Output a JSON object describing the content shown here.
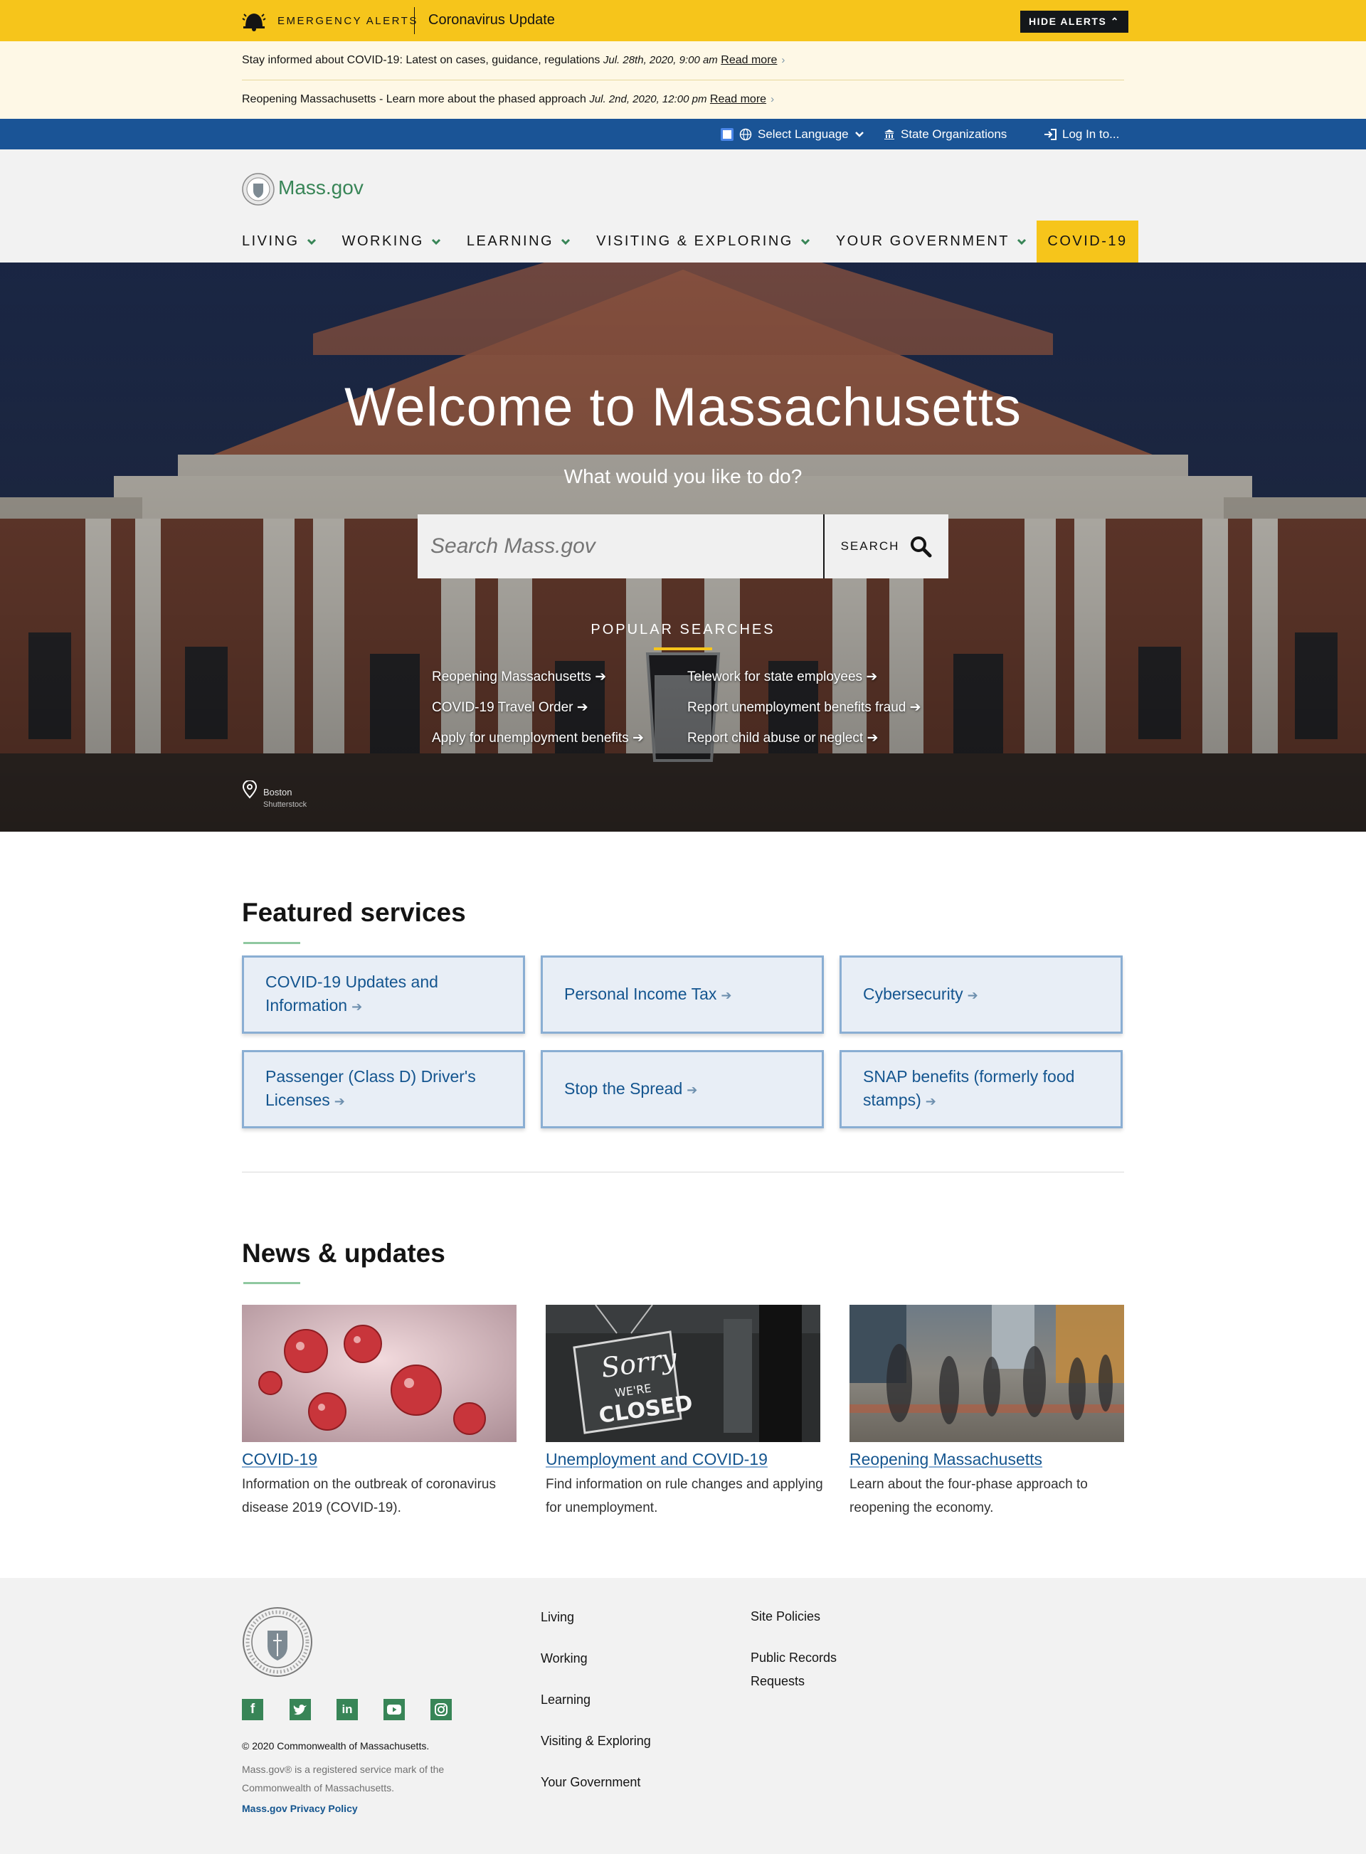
{
  "alerts": {
    "label": "EMERGENCY ALERTS",
    "title": "Coronavirus Update",
    "hide_button": "HIDE ALERTS",
    "items": [
      {
        "text": "Stay informed about COVID-19: Latest on cases, guidance, regulations",
        "date": "Jul. 28th, 2020, 9:00 am",
        "link": "Read more"
      },
      {
        "text": "Reopening Massachusetts - Learn more about the phased approach",
        "date": "Jul. 2nd, 2020, 12:00 pm",
        "link": "Read more"
      }
    ]
  },
  "utility": {
    "language": "Select Language",
    "orgs": "State Organizations",
    "login": "Log In to..."
  },
  "header": {
    "logo": "Mass.gov",
    "nav": [
      "LIVING",
      "WORKING",
      "LEARNING",
      "VISITING & EXPLORING",
      "YOUR GOVERNMENT"
    ],
    "covid": "COVID-19"
  },
  "hero": {
    "title": "Welcome to Massachusetts",
    "subtitle": "What would you like to do?",
    "search_placeholder": "Search Mass.gov",
    "search_button": "SEARCH",
    "popular_heading": "POPULAR SEARCHES",
    "popular": [
      "Reopening Massachusetts",
      "COVID-19 Travel Order",
      "Apply for unemployment benefits",
      "Telework for state employees",
      "Report unemployment benefits fraud",
      "Report child abuse or neglect"
    ],
    "caption_place": "Boston",
    "caption_credit": "Shutterstock"
  },
  "featured": {
    "title": "Featured services",
    "cards": [
      "COVID-19 Updates and Information",
      "Personal Income Tax",
      "Cybersecurity",
      "Passenger (Class D) Driver's Licenses",
      "Stop the Spread",
      "SNAP benefits (formerly food stamps)"
    ]
  },
  "news": {
    "title": "News & updates",
    "items": [
      {
        "title": "COVID-19",
        "desc": "Information on the outbreak of coronavirus disease 2019 (COVID-19)."
      },
      {
        "title": "Unemployment and COVID-19",
        "desc": "Find information on rule changes and applying for unemployment."
      },
      {
        "title": "Reopening Massachusetts",
        "desc": "Learn about the four-phase approach to reopening the economy."
      }
    ],
    "sign_line1": "Sorry",
    "sign_line2": "WE'RE",
    "sign_line3": "CLOSED"
  },
  "footer": {
    "copyright": "© 2020 Commonwealth of Massachusetts.",
    "trademark": "Mass.gov® is a registered service mark of the Commonwealth of Massachusetts.",
    "privacy": "Mass.gov Privacy Policy",
    "nav": [
      "Living",
      "Working",
      "Learning",
      "Visiting & Exploring",
      "Your Government"
    ],
    "policies": [
      "Site Policies",
      "Public Records Requests"
    ],
    "social": [
      "facebook-icon",
      "twitter-icon",
      "linkedin-icon",
      "youtube-icon",
      "instagram-icon"
    ]
  },
  "colors": {
    "alert_yellow": "#f6c51b",
    "util_blue": "#1a5496",
    "brand_green": "#388557",
    "link_blue": "#14558f"
  }
}
